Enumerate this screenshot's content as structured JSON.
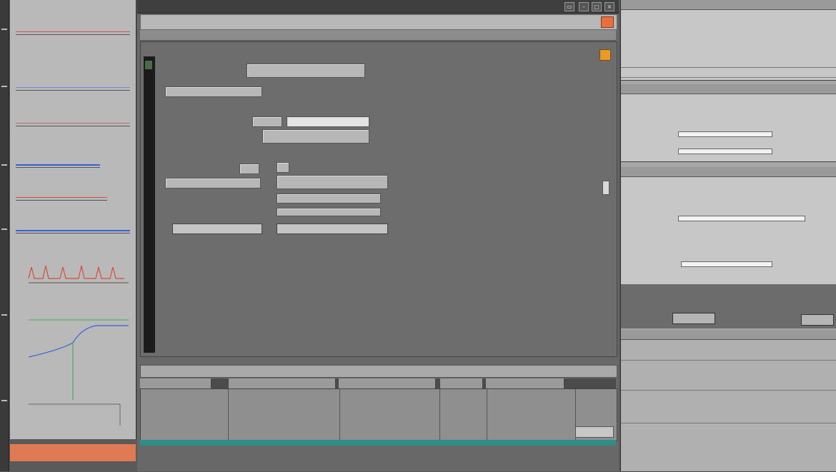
{
  "left_panel": {
    "footer_label": ""
  },
  "window": {
    "title": "",
    "toolbar_label": "",
    "menu_label": ""
  },
  "form": {
    "heading_right": "",
    "field1": "",
    "field2_label": "",
    "field2_value": "",
    "field3": "",
    "field4_label": "",
    "field4_value": "",
    "field5_label": "",
    "field5_value": "",
    "field6_label": "",
    "field6_value": "",
    "field7_label": "",
    "field7_value": "",
    "field8_label": "",
    "field8_value": "",
    "label_a": "",
    "label_b": "",
    "big_label": "",
    "button_left": "",
    "button_right": ""
  },
  "status": {
    "text": ""
  },
  "bottom_tabs": [
    "",
    "",
    "",
    "",
    ""
  ],
  "right_panel": {
    "section1_title": "",
    "section2_title": "",
    "section3_title": "",
    "section4_title": ""
  },
  "colors": {
    "accent_orange": "#e6703f",
    "teal": "#2f8e86",
    "trace_red": "#d94b3b",
    "trace_blue": "#3b5fd9",
    "trace_green": "#3fae5a"
  }
}
